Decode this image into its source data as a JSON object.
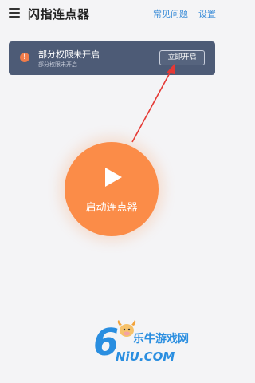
{
  "header": {
    "menu_icon": "hamburger-icon",
    "title": "闪指连点器",
    "faq_label": "常见问题",
    "settings_label": "设置"
  },
  "permission_banner": {
    "icon": "warning-icon",
    "icon_glyph": "!",
    "title": "部分权限未开启",
    "subtitle": "部分权限未开启",
    "button_label": "立即开启",
    "background_color": "#4d5b76",
    "icon_color": "#f07c4a"
  },
  "annotation": {
    "arrow_color": "#e53935"
  },
  "main": {
    "start_button_icon": "play-icon",
    "start_button_label": "启动连点器",
    "start_button_color": "#fb8c48"
  },
  "watermark": {
    "logo_digit": "6",
    "site_name": "乐牛游戏网",
    "url_text": "NiU.COM",
    "color": "#2a8ee0"
  },
  "colors": {
    "link": "#3b8dd8",
    "page_background": "#f4f4f6"
  }
}
